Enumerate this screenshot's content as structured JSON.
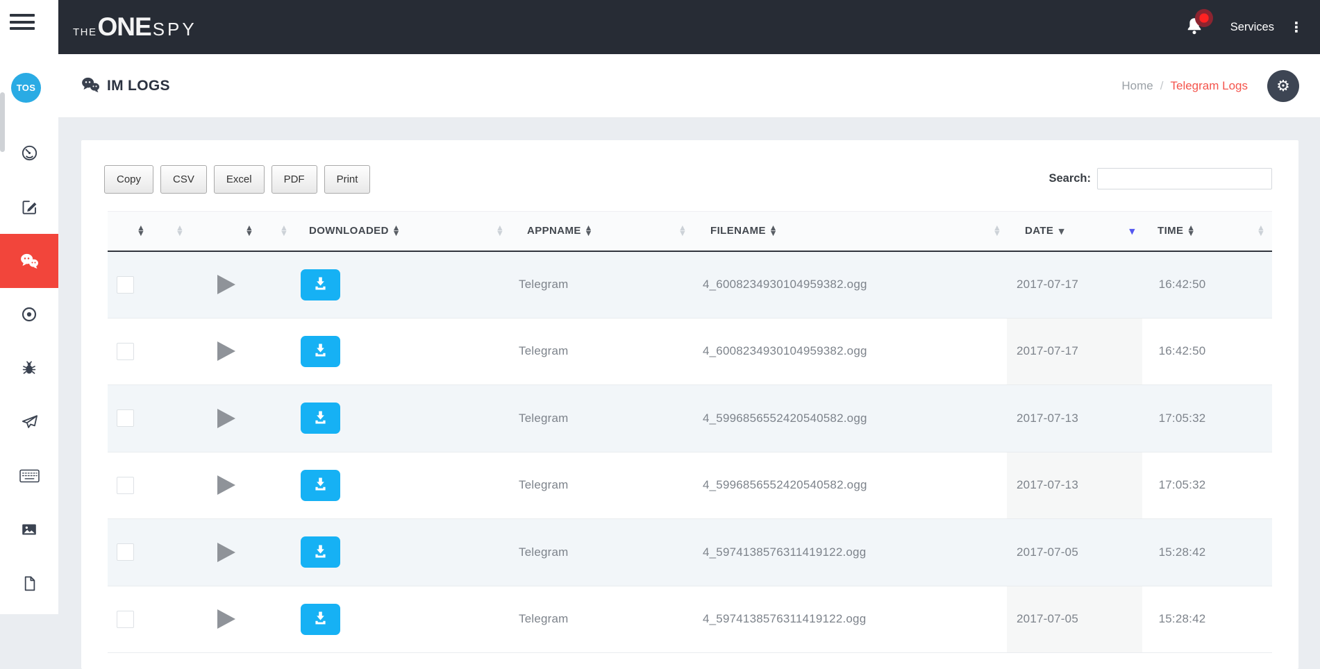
{
  "navbar": {
    "logo": {
      "prefix": "THE",
      "middle": "ONE",
      "suffix": "SPY"
    },
    "services_label": "Services"
  },
  "sidebar": {
    "avatar_text": "TOS",
    "items": [
      {
        "icon": "dashboard-icon",
        "active": false
      },
      {
        "icon": "compose-icon",
        "active": false
      },
      {
        "icon": "chat-icon",
        "active": true
      },
      {
        "icon": "target-icon",
        "active": false
      },
      {
        "icon": "bug-icon",
        "active": false
      },
      {
        "icon": "send-icon",
        "active": false
      },
      {
        "icon": "keyboard-icon",
        "active": false
      },
      {
        "icon": "image-icon",
        "active": false
      },
      {
        "icon": "document-icon",
        "active": false
      }
    ]
  },
  "page_header": {
    "title": "IM LOGS",
    "title_icon": "chat-bubbles-icon",
    "breadcrumb": {
      "home": "Home",
      "separator": "/",
      "current": "Telegram Logs"
    },
    "settings_icon": "gear-icon"
  },
  "toolbar": {
    "buttons": [
      {
        "label": "Copy"
      },
      {
        "label": "CSV"
      },
      {
        "label": "Excel"
      },
      {
        "label": "PDF"
      },
      {
        "label": "Print"
      }
    ],
    "search_label": "Search:",
    "search_value": ""
  },
  "table": {
    "columns": [
      {
        "id": "select",
        "label": "",
        "sort": "both-dark"
      },
      {
        "id": "hidden-1",
        "label": "",
        "sort": "both-light"
      },
      {
        "id": "play",
        "label": "",
        "sort": "both-dark"
      },
      {
        "id": "hidden-2",
        "label": "",
        "sort": "both-light"
      },
      {
        "id": "downloaded",
        "label": "DOWNLOADED",
        "sort": "both-dark"
      },
      {
        "id": "hidden-3",
        "label": "",
        "sort": "both-light"
      },
      {
        "id": "appname",
        "label": "APPNAME",
        "sort": "both-dark"
      },
      {
        "id": "hidden-4",
        "label": "",
        "sort": "both-light"
      },
      {
        "id": "filename",
        "label": "FILENAME",
        "sort": "both-dark"
      },
      {
        "id": "hidden-5",
        "label": "",
        "sort": "both-light"
      },
      {
        "id": "date",
        "label": "DATE",
        "sort": "desc-dark"
      },
      {
        "id": "hidden-6",
        "label": "",
        "sort": "desc-blue"
      },
      {
        "id": "time",
        "label": "TIME",
        "sort": "both-dark"
      },
      {
        "id": "hidden-7",
        "label": "",
        "sort": "both-light"
      }
    ],
    "rows": [
      {
        "appname": "Telegram",
        "filename": "4_6008234930104959382.ogg",
        "date": "2017-07-17",
        "time": "16:42:50"
      },
      {
        "appname": "Telegram",
        "filename": "4_6008234930104959382.ogg",
        "date": "2017-07-17",
        "time": "16:42:50"
      },
      {
        "appname": "Telegram",
        "filename": "4_5996856552420540582.ogg",
        "date": "2017-07-13",
        "time": "17:05:32"
      },
      {
        "appname": "Telegram",
        "filename": "4_5996856552420540582.ogg",
        "date": "2017-07-13",
        "time": "17:05:32"
      },
      {
        "appname": "Telegram",
        "filename": "4_5974138576311419122.ogg",
        "date": "2017-07-05",
        "time": "15:28:42"
      },
      {
        "appname": "Telegram",
        "filename": "4_5974138576311419122.ogg",
        "date": "2017-07-05",
        "time": "15:28:42"
      }
    ]
  },
  "icons": {
    "gear_glyph": "⚙",
    "kebab_glyph": "⋮",
    "sort_up_glyph": "▲",
    "sort_down_glyph": "▼"
  },
  "colors": {
    "navbar_dark": "#272c35",
    "sidebar_active_red": "#f2453b",
    "avatar_blue": "#2aabe4",
    "download_blue": "#16b1f4",
    "breadcrumb_red": "#f4544c",
    "sort_active_blue": "#5457f0"
  }
}
